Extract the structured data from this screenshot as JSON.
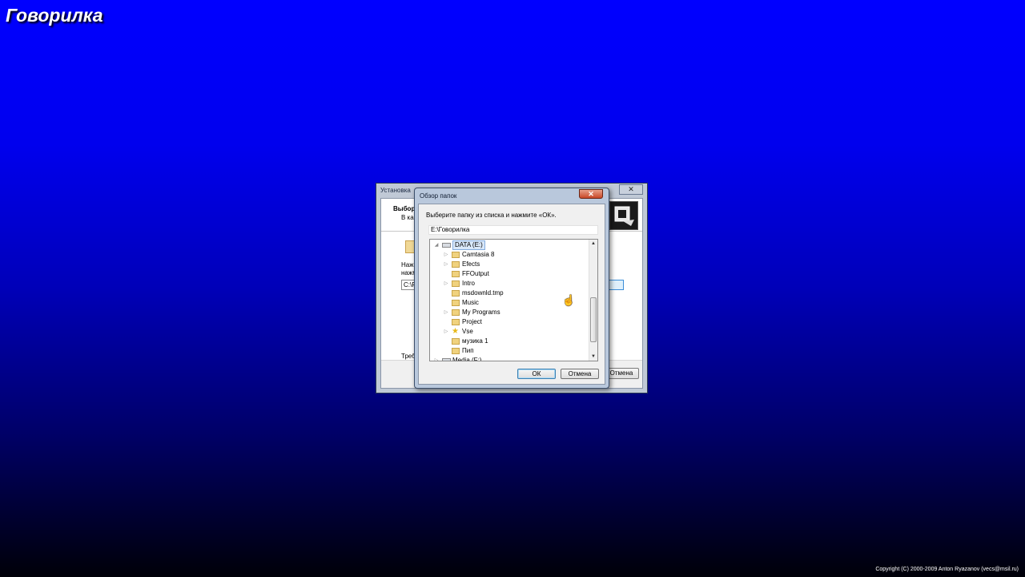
{
  "brand": {
    "title": "Говорилка"
  },
  "copyright": "Copyright (C) 2000-2009 Anton Ryazanov (vecs@msil.ru)",
  "setup_window": {
    "title": "Установка",
    "close_glyph": "✕",
    "header_title": "Выбор",
    "header_subtitle": "В ка",
    "text_line1": "Нажм",
    "text_line2": "нажм",
    "path_value": "C:\\P",
    "requirement_text": "Треб",
    "cancel_label": "Отмена"
  },
  "browse_dialog": {
    "title": "Обзор папок",
    "close_glyph": "✕",
    "instruction": "Выберите папку из списка и нажмите «ОК».",
    "path_value": "E:\\Говорилка",
    "tree": [
      {
        "label": "DATA (E:)",
        "type": "drive",
        "expander": "◢",
        "selected": true
      },
      {
        "label": "Camtasia 8",
        "type": "folder",
        "expander": "▷"
      },
      {
        "label": "Efects",
        "type": "folder",
        "expander": "▷"
      },
      {
        "label": "FFOutput",
        "type": "folder",
        "expander": ""
      },
      {
        "label": "Intro",
        "type": "folder",
        "expander": "▷"
      },
      {
        "label": "msdownld.tmp",
        "type": "folder",
        "expander": ""
      },
      {
        "label": "Music",
        "type": "folder",
        "expander": ""
      },
      {
        "label": "My Programs",
        "type": "folder",
        "expander": "▷"
      },
      {
        "label": "Project",
        "type": "folder",
        "expander": ""
      },
      {
        "label": "Vse",
        "type": "star-folder",
        "expander": "▷"
      },
      {
        "label": "музика 1",
        "type": "folder",
        "expander": ""
      },
      {
        "label": "Пип",
        "type": "folder",
        "expander": ""
      },
      {
        "label": "Media (F:)",
        "type": "drive",
        "expander": "▷"
      }
    ],
    "ok_label": "ОК",
    "cancel_label": "Отмена"
  }
}
